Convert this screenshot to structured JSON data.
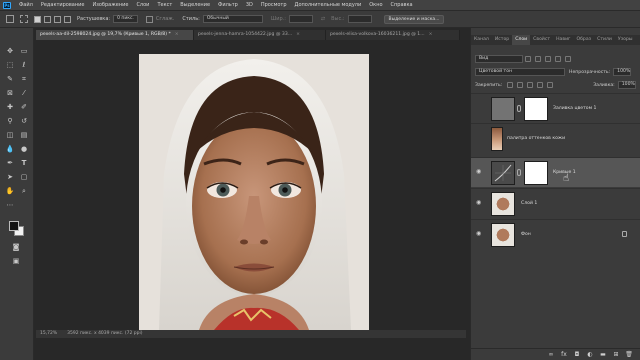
{
  "menu": [
    "Файл",
    "Редактирование",
    "Изображение",
    "Слои",
    "Текст",
    "Выделение",
    "Фильтр",
    "3D",
    "Просмотр",
    "Дополнительные модули",
    "Окно",
    "Справка"
  ],
  "options": {
    "feather_label": "Растушевка:",
    "feather_value": "0 пикс.",
    "antialias_label": "Сглаж.",
    "style_label": "Стиль:",
    "style_value": "Обычный",
    "width_label": "Шир.:",
    "height_label": "Выс.:",
    "select_mask_button": "Выделение и маска..."
  },
  "doc_tabs": [
    {
      "label": "pexels-aa-dil-2598024.jpg @ 19,7% (Кривые 1, RGB/8) *",
      "active": true
    },
    {
      "label": "pexels-jenna-hamra-1054422.jpg @ 33...",
      "active": false
    },
    {
      "label": "pexels-elisa-volkova-16036211.jpg @ 1...",
      "active": false
    }
  ],
  "status": {
    "zoom": "15,72%",
    "doc_size": "3592 пикс. x 4039 пикс. (72 ppi)"
  },
  "panel_tabs": [
    "Канал",
    "Истор",
    "Слои",
    "Свойст",
    "Навиг",
    "Образ",
    "Стили",
    "Узоры"
  ],
  "active_panel_tab": "Слои",
  "layers_panel": {
    "filter_kind": "Вид",
    "blend_mode": "Цветовой тон",
    "opacity_label": "Непрозрачность:",
    "opacity_value": "100%",
    "lock_label": "Закрепить:",
    "fill_label": "Заливка:",
    "fill_value": "100%"
  },
  "layers": [
    {
      "name": "Заливка цветом 1",
      "visible": false,
      "selected": false,
      "kind": "fill"
    },
    {
      "name": "палитра оттенков кожи",
      "visible": false,
      "selected": false,
      "kind": "palette"
    },
    {
      "name": "Кривые 1",
      "visible": true,
      "selected": true,
      "kind": "curves"
    },
    {
      "name": "Слой 1",
      "visible": true,
      "selected": false,
      "kind": "photo"
    },
    {
      "name": "Фон",
      "visible": true,
      "selected": false,
      "kind": "photo",
      "locked": true
    }
  ],
  "colors": {
    "accent": "#31a8ff",
    "foreground_swatch": "#141414",
    "background_swatch": "#f2f2f2",
    "fill_layer_color": "#737373",
    "skin_palette": [
      "#8c5a3c",
      "#a8765a",
      "#c49474",
      "#d9b296",
      "#e8cdb6"
    ]
  }
}
